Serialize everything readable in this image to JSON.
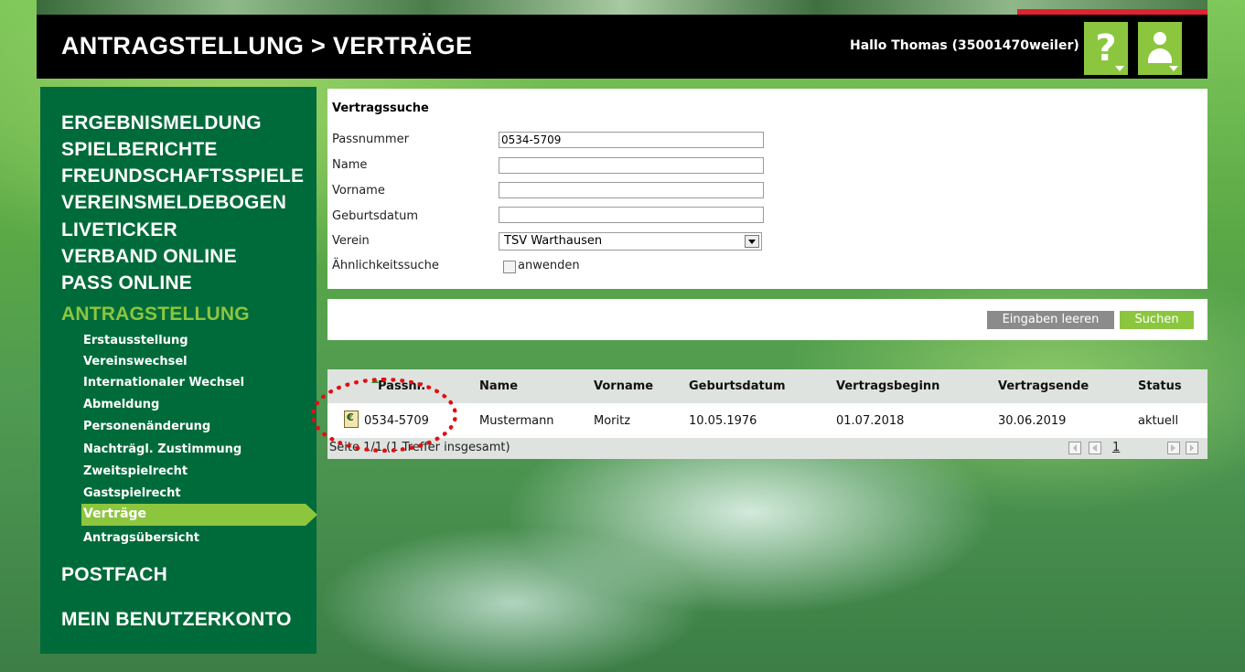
{
  "header": {
    "title": "ANTRAGSTELLUNG > VERTRÄGE",
    "greeting": "Hallo Thomas (35001470weiler)",
    "help_label": "?"
  },
  "sidebar": {
    "main_items": [
      {
        "label": "ERGEBNISMELDUNG"
      },
      {
        "label": "SPIELBERICHTE"
      },
      {
        "label": "FREUNDSCHAFTSSPIELE"
      },
      {
        "label": "VEREINSMELDEBOGEN"
      },
      {
        "label": "LIVETICKER"
      },
      {
        "label": "VERBAND ONLINE"
      },
      {
        "label": "PASS ONLINE"
      },
      {
        "label": "ANTRAGSTELLUNG"
      }
    ],
    "sub_items": [
      {
        "label": "Erstausstellung"
      },
      {
        "label": "Vereinswechsel"
      },
      {
        "label": "Internationaler Wechsel"
      },
      {
        "label": "Abmeldung"
      },
      {
        "label": "Personenänderung"
      },
      {
        "label": "Nachträgl. Zustimmung"
      },
      {
        "label": "Zweitspielrecht"
      },
      {
        "label": "Gastspielrecht"
      },
      {
        "label": "Verträge"
      },
      {
        "label": "Antragsübersicht"
      }
    ],
    "postfach": "POSTFACH",
    "account": "MEIN BENUTZERKONTO"
  },
  "search": {
    "title": "Vertragssuche",
    "fields": {
      "passnummer": {
        "label": "Passnummer",
        "value": "0534-5709"
      },
      "name": {
        "label": "Name",
        "value": ""
      },
      "vorname": {
        "label": "Vorname",
        "value": ""
      },
      "geburtsdatum": {
        "label": "Geburtsdatum",
        "value": ""
      },
      "verein": {
        "label": "Verein",
        "value": "TSV Warthausen"
      },
      "aehnlichkeit": {
        "label": "Ähnlichkeitssuche",
        "checkbox_label": "anwenden",
        "checked": false
      }
    }
  },
  "actions": {
    "clear_label": "Eingaben leeren",
    "search_label": "Suchen"
  },
  "results": {
    "columns": [
      "Passnr.",
      "Name",
      "Vorname",
      "Geburtsdatum",
      "Vertragsbeginn",
      "Vertragsende",
      "Status"
    ],
    "rows": [
      {
        "passnr": "0534-5709",
        "name": "Mustermann",
        "vorname": "Moritz",
        "geburtsdatum": "10.05.1976",
        "vertragsbeginn": "01.07.2018",
        "vertragsende": "30.06.2019",
        "status": "aktuell"
      }
    ],
    "footer_info": "Seite 1/1 (1 Treffer insgesamt)",
    "page_number": "1"
  },
  "colors": {
    "brand_green": "#006b3a",
    "accent_green": "#8cc63f",
    "highlight_red": "#e01010"
  }
}
